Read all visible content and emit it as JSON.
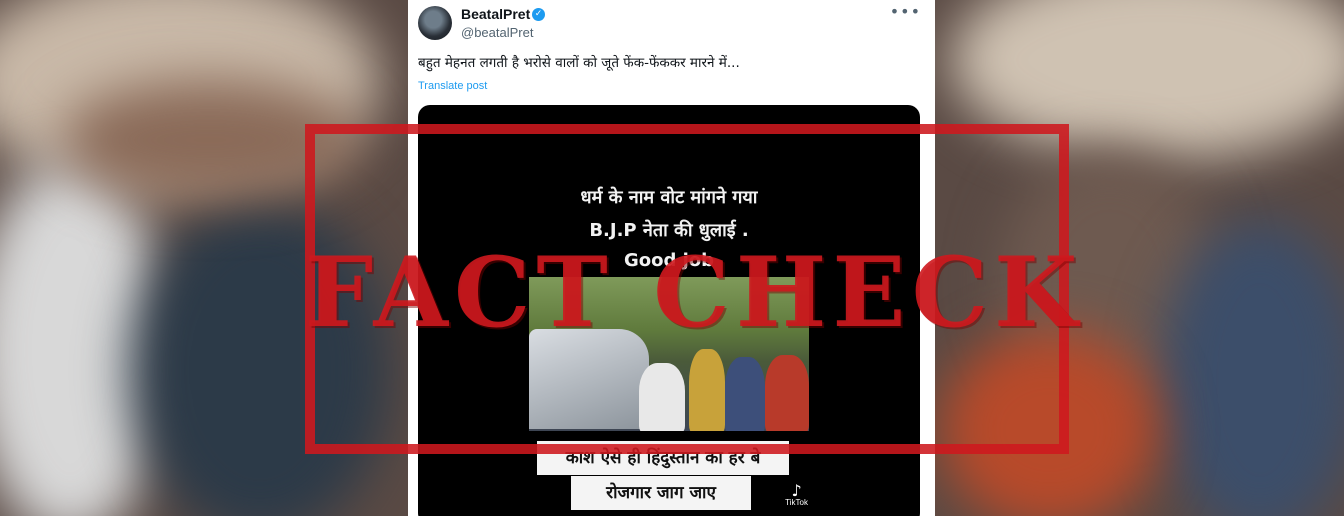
{
  "post": {
    "display_name": "BeatalPret",
    "handle": "@beatalPret",
    "verified_icon": "verified-badge-icon",
    "more_icon": "more-options-icon",
    "text": "बहुत मेहनत लगती है भरोसे वालों को जूते फेंक-फेंककर मारने में...",
    "translate_label": "Translate post"
  },
  "video": {
    "caption_top_line1": "धर्म के नाम वोट मांगने गया",
    "caption_top_line2": "B.J.P नेता की धुलाई .",
    "caption_top_line3": "Good job",
    "caption_bottom_line1": "काश ऐसे ही हिंदुस्तान का हर बे",
    "caption_bottom_line2": "रोजगार जाग जाए",
    "watermark_label": "TikTok",
    "watermark_icon": "tiktok-logo-icon"
  },
  "overlay": {
    "stamp_text": "FACT CHECK",
    "stamp_color": "#ce181e"
  }
}
